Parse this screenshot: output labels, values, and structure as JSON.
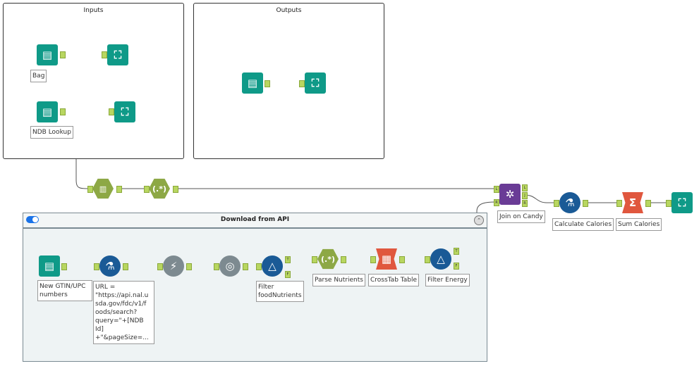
{
  "containers": {
    "inputs": {
      "title": "Inputs"
    },
    "outputs": {
      "title": "Outputs"
    },
    "download": {
      "title": "Download from API",
      "enabled": true
    }
  },
  "tools": {
    "bag": {
      "label": "Bag",
      "icon": "text-input-icon"
    },
    "ndb_lookup": {
      "label": "NDB Lookup",
      "icon": "text-input-icon"
    },
    "new_gtin": {
      "label": "New GTIN/UPC\nnumbers",
      "icon": "text-input-icon"
    },
    "formula_url": {
      "label": "URL =\n\"https://api.nal.u\nsda.gov/fdc/v1/f\noods/search?\nquery=\"+[NDB\nId]\n+\"&pageSize=...",
      "icon": "formula-icon"
    },
    "filter_food": {
      "label": "Filter\nfoodNutrients",
      "icon": "filter-icon"
    },
    "parse_nutrients": {
      "label": "Parse Nutrients",
      "icon": "regex-icon"
    },
    "crosstab": {
      "label": "CrossTab Table",
      "icon": "crosstab-icon"
    },
    "filter_energy": {
      "label": "Filter Energy",
      "icon": "filter-icon"
    },
    "join": {
      "label": "Join on Candy",
      "icon": "join-icon"
    },
    "calculate": {
      "label": "Calculate Calories",
      "icon": "formula-icon"
    },
    "sum": {
      "label": "Sum Calories",
      "icon": "summarize-icon"
    }
  },
  "glyphs": {
    "regex": "(.*)",
    "sum": "Σ",
    "download": "⚡",
    "json": "◎",
    "filter": "△",
    "browse": "⛶",
    "input": "▤",
    "formula": "⚗",
    "join": "✲",
    "collapse": "⌃",
    "crosstab": "▦",
    "textcols": "▥"
  },
  "anchors": {
    "true": "T",
    "false": "F",
    "left": "L",
    "join": "J",
    "right": "R"
  },
  "colors": {
    "input": "#0f9a88",
    "formula": "#1a5a96",
    "join": "#6a3c96",
    "parse": "#8da845",
    "transform": "#e0573e",
    "developer": "#7d8a90"
  }
}
